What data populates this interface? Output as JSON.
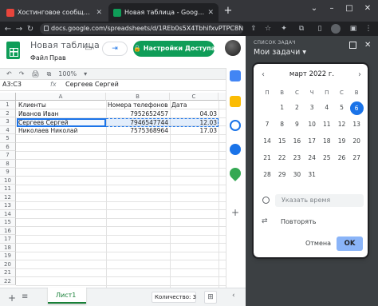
{
  "browser": {
    "tabs": [
      {
        "title": "Хостинговое сообщество «Tim",
        "favicon_color": "#e8453c"
      },
      {
        "title": "Новая таблица - Google Табли",
        "favicon_color": "#0f9d58"
      }
    ],
    "url": "docs.google.com/spreadsheets/d/1REb0s5X4TbhifxvPTPC8NAHXoiF...",
    "new_tab": "+",
    "win_controls": {
      "chevron": "⌄",
      "minimize": "–",
      "maximize": "□",
      "close": "✕"
    },
    "nav": {
      "back": "←",
      "forward": "→",
      "reload": "↻"
    }
  },
  "sheets": {
    "title": "Новая таблица",
    "menu": {
      "file": "Файл",
      "edit": "Прав"
    },
    "meet_icon": "▭",
    "present_icon": "⇥",
    "share_label": "🔒 Настройки Доступа",
    "toolbar_icons": [
      "↶",
      "↷",
      "🖨",
      "⧉",
      "100%",
      "▾"
    ],
    "namebox": "A3:C3",
    "fx": "fx",
    "formula": "Сергеев Сергей",
    "columns": [
      "A",
      "B",
      "C"
    ],
    "rows": [
      "1",
      "2",
      "3",
      "4",
      "5",
      "6",
      "7",
      "8",
      "9",
      "10",
      "11",
      "12",
      "13",
      "14",
      "15",
      "16",
      "17",
      "18",
      "19",
      "20",
      "21",
      "22"
    ],
    "cells": [
      [
        "Клиенты",
        "Номера телефонов",
        "Дата"
      ],
      [
        "Иванов Иван",
        "7952652457",
        "04.03"
      ],
      [
        "Сергеев Сергей",
        "7946547744",
        "12.03"
      ],
      [
        "Николаев Николай",
        "7575368964",
        "17.03"
      ]
    ],
    "sheet_tab": "Лист1",
    "count": "Количество: 3",
    "add_sheet": "+",
    "all_sheets": "≡",
    "explore_icon": "⊞",
    "collapse_icon": "‹"
  },
  "side_icons": [
    {
      "name": "calendar-icon",
      "color": "#4285f4"
    },
    {
      "name": "keep-icon",
      "color": "#fbbc04"
    },
    {
      "name": "tasks-icon",
      "color": "#1a73e8"
    },
    {
      "name": "contacts-icon",
      "color": "#1a73e8"
    },
    {
      "name": "maps-icon",
      "color": "#34a853"
    }
  ],
  "side_add": "+",
  "tasks": {
    "caption": "СПИСОК ЗАДАЧ",
    "title": "Мои задачи ▾",
    "close": "✕",
    "calendar": {
      "month": "март 2022 г.",
      "prev": "‹",
      "next": "›",
      "dow": [
        "П",
        "В",
        "С",
        "Ч",
        "П",
        "С",
        "В"
      ],
      "weeks": [
        [
          "",
          "1",
          "2",
          "3",
          "4",
          "5",
          "6"
        ],
        [
          "7",
          "8",
          "9",
          "10",
          "11",
          "12",
          "13"
        ],
        [
          "14",
          "15",
          "16",
          "17",
          "18",
          "19",
          "20"
        ],
        [
          "21",
          "22",
          "23",
          "24",
          "25",
          "26",
          "27"
        ],
        [
          "28",
          "29",
          "30",
          "31",
          "",
          "",
          ""
        ]
      ],
      "today": "6"
    },
    "time_placeholder": "Указать время",
    "repeat": "Повторять",
    "repeat_icon": "⇄",
    "cancel": "Отмена",
    "ok": "OK"
  }
}
